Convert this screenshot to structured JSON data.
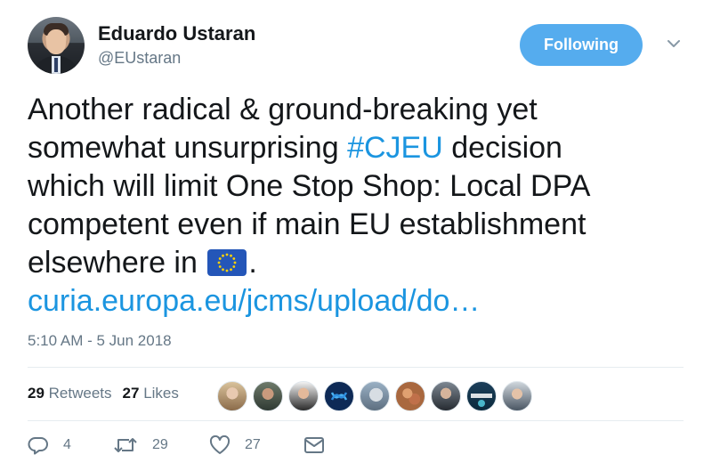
{
  "user": {
    "display_name": "Eduardo Ustaran",
    "handle": "@EUstaran",
    "avatar": "profile-photo"
  },
  "follow_button": {
    "label": "Following",
    "color": "#55acee"
  },
  "tweet": {
    "line1": "Another radical & ground-breaking yet",
    "line2_before": "somewhat unsurprising ",
    "hashtag": "#CJEU",
    "line2_after": " decision",
    "line3": "which will limit One Stop Shop: Local DPA",
    "line4": "competent even if main EU establishment",
    "line5_before": "elsewhere in ",
    "emoji": "eu-flag",
    "line5_after": ".",
    "link": "curia.europa.eu/jcms/upload/do…",
    "link_color": "#1b95e0"
  },
  "timestamp": "5:10 AM - 5 Jun 2018",
  "stats": {
    "retweets_count": "29",
    "retweets_label": "Retweets",
    "likes_count": "27",
    "likes_label": "Likes"
  },
  "liked_by": [
    "avatar-1",
    "avatar-2",
    "avatar-3",
    "avatar-4",
    "avatar-5",
    "avatar-6",
    "avatar-7",
    "avatar-8",
    "avatar-9"
  ],
  "actions": {
    "replies": "4",
    "retweets": "29",
    "likes": "27"
  },
  "icons": [
    "chevron-down-icon",
    "reply-icon",
    "retweet-icon",
    "like-icon",
    "message-icon"
  ]
}
